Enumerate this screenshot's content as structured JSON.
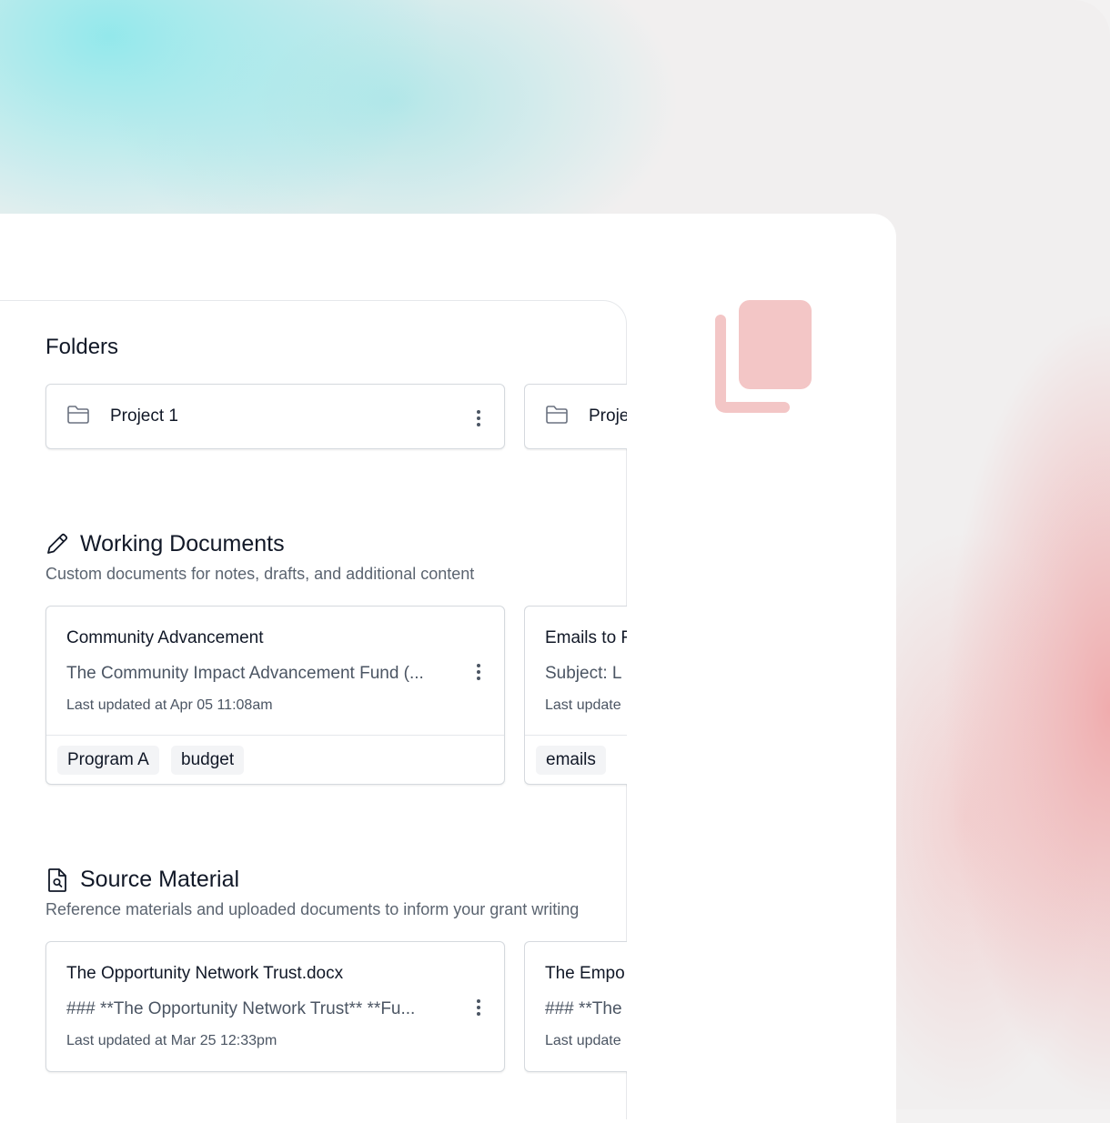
{
  "colors": {
    "accent_icon": "#f3c6c6",
    "text": "#111827",
    "muted": "#5b6470",
    "border": "#d5d9de"
  },
  "folders": {
    "title": "Folders",
    "items": [
      {
        "name": "Project 1",
        "icon": "folder-icon"
      },
      {
        "name": "Proje",
        "icon": "folder-icon"
      }
    ]
  },
  "working": {
    "title": "Working Documents",
    "icon": "pencil-icon",
    "subtitle": "Custom documents for notes, drafts, and additional content",
    "cards": [
      {
        "title": "Community Advancement",
        "snippet": "The Community Impact Advancement Fund (...",
        "date": "Last updated at Apr 05 11:08am",
        "tags": [
          "Program A",
          "budget"
        ]
      },
      {
        "title": "Emails to F",
        "snippet": "Subject: L",
        "date": "Last update",
        "tags": [
          "emails"
        ]
      }
    ]
  },
  "source": {
    "title": "Source Material",
    "icon": "file-search-icon",
    "subtitle": "Reference materials and uploaded documents to inform your grant writing",
    "cards": [
      {
        "title": "The Opportunity Network Trust.docx",
        "snippet": "### **The Opportunity Network Trust** **Fu...",
        "date": "Last updated at Mar 25 12:33pm"
      },
      {
        "title": "The Empo",
        "snippet": "### **The",
        "date": "Last update"
      }
    ]
  },
  "decor": {
    "icon": "copy-icon"
  }
}
